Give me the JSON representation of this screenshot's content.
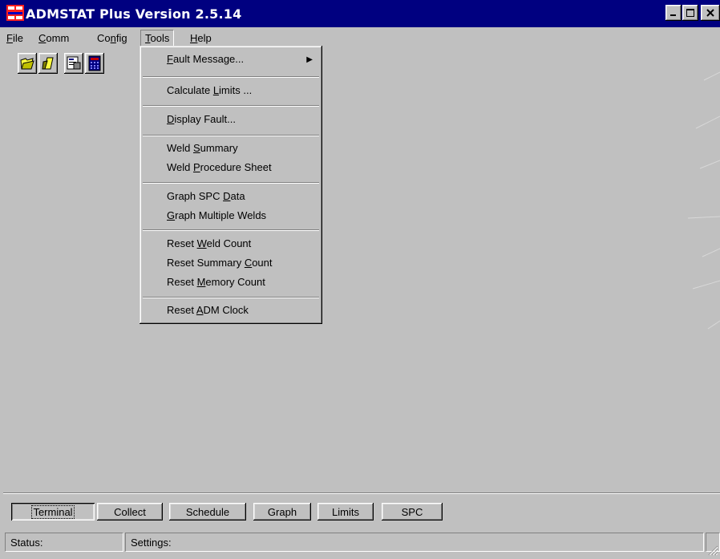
{
  "window": {
    "title": "ADMSTAT Plus Version 2.5.14"
  },
  "menubar": {
    "items": [
      {
        "label": "File",
        "mnemonic": "F",
        "rest": "ile"
      },
      {
        "label": "Comm",
        "mnemonic": "C",
        "rest": "omm"
      },
      {
        "label": "Config",
        "pre": "Co",
        "mnemonic": "n",
        "rest": "fig"
      },
      {
        "label": "Tools",
        "mnemonic": "T",
        "rest": "ools"
      },
      {
        "label": "Help",
        "mnemonic": "H",
        "rest": "elp"
      }
    ]
  },
  "toolbar": {
    "buttons": [
      "open-folder-icon",
      "open-file-icon",
      "properties-icon",
      "calculator-icon"
    ]
  },
  "tools_menu": {
    "items": [
      {
        "label": "Fault Message...",
        "pre": "",
        "mn": "F",
        "post": "ault Message...",
        "submenu": true
      },
      {
        "label": "Calculate Limits ...",
        "pre": "Calculate ",
        "mn": "L",
        "post": "imits ..."
      },
      {
        "label": "Display Fault...",
        "pre": "",
        "mn": "D",
        "post": "isplay Fault..."
      },
      {
        "label": "Weld Summary",
        "pre": "Weld ",
        "mn": "S",
        "post": "ummary"
      },
      {
        "label": "Weld Procedure Sheet",
        "pre": "Weld ",
        "mn": "P",
        "post": "rocedure Sheet"
      },
      {
        "label": "Graph SPC Data",
        "pre": "Graph SPC ",
        "mn": "D",
        "post": "ata"
      },
      {
        "label": "Graph Multiple Welds",
        "pre": "",
        "mn": "G",
        "post": "raph Multiple Welds"
      },
      {
        "label": "Reset Weld Count",
        "pre": "Reset ",
        "mn": "W",
        "post": "eld Count"
      },
      {
        "label": "Reset Summary Count",
        "pre": "Reset Summary ",
        "mn": "C",
        "post": "ount"
      },
      {
        "label": "Reset Memory Count",
        "pre": "Reset ",
        "mn": "M",
        "post": "emory Count"
      },
      {
        "label": "Reset ADM Clock",
        "pre": "Reset ",
        "mn": "A",
        "post": "DM Clock"
      }
    ]
  },
  "bottom_buttons": [
    "Terminal",
    "Collect",
    "Schedule",
    "Graph",
    "Limits",
    "SPC"
  ],
  "statusbar": {
    "status_label": "Status:",
    "settings_label": "Settings:"
  },
  "colors": {
    "titlebar": "#000080",
    "face": "#c0c0c0"
  }
}
